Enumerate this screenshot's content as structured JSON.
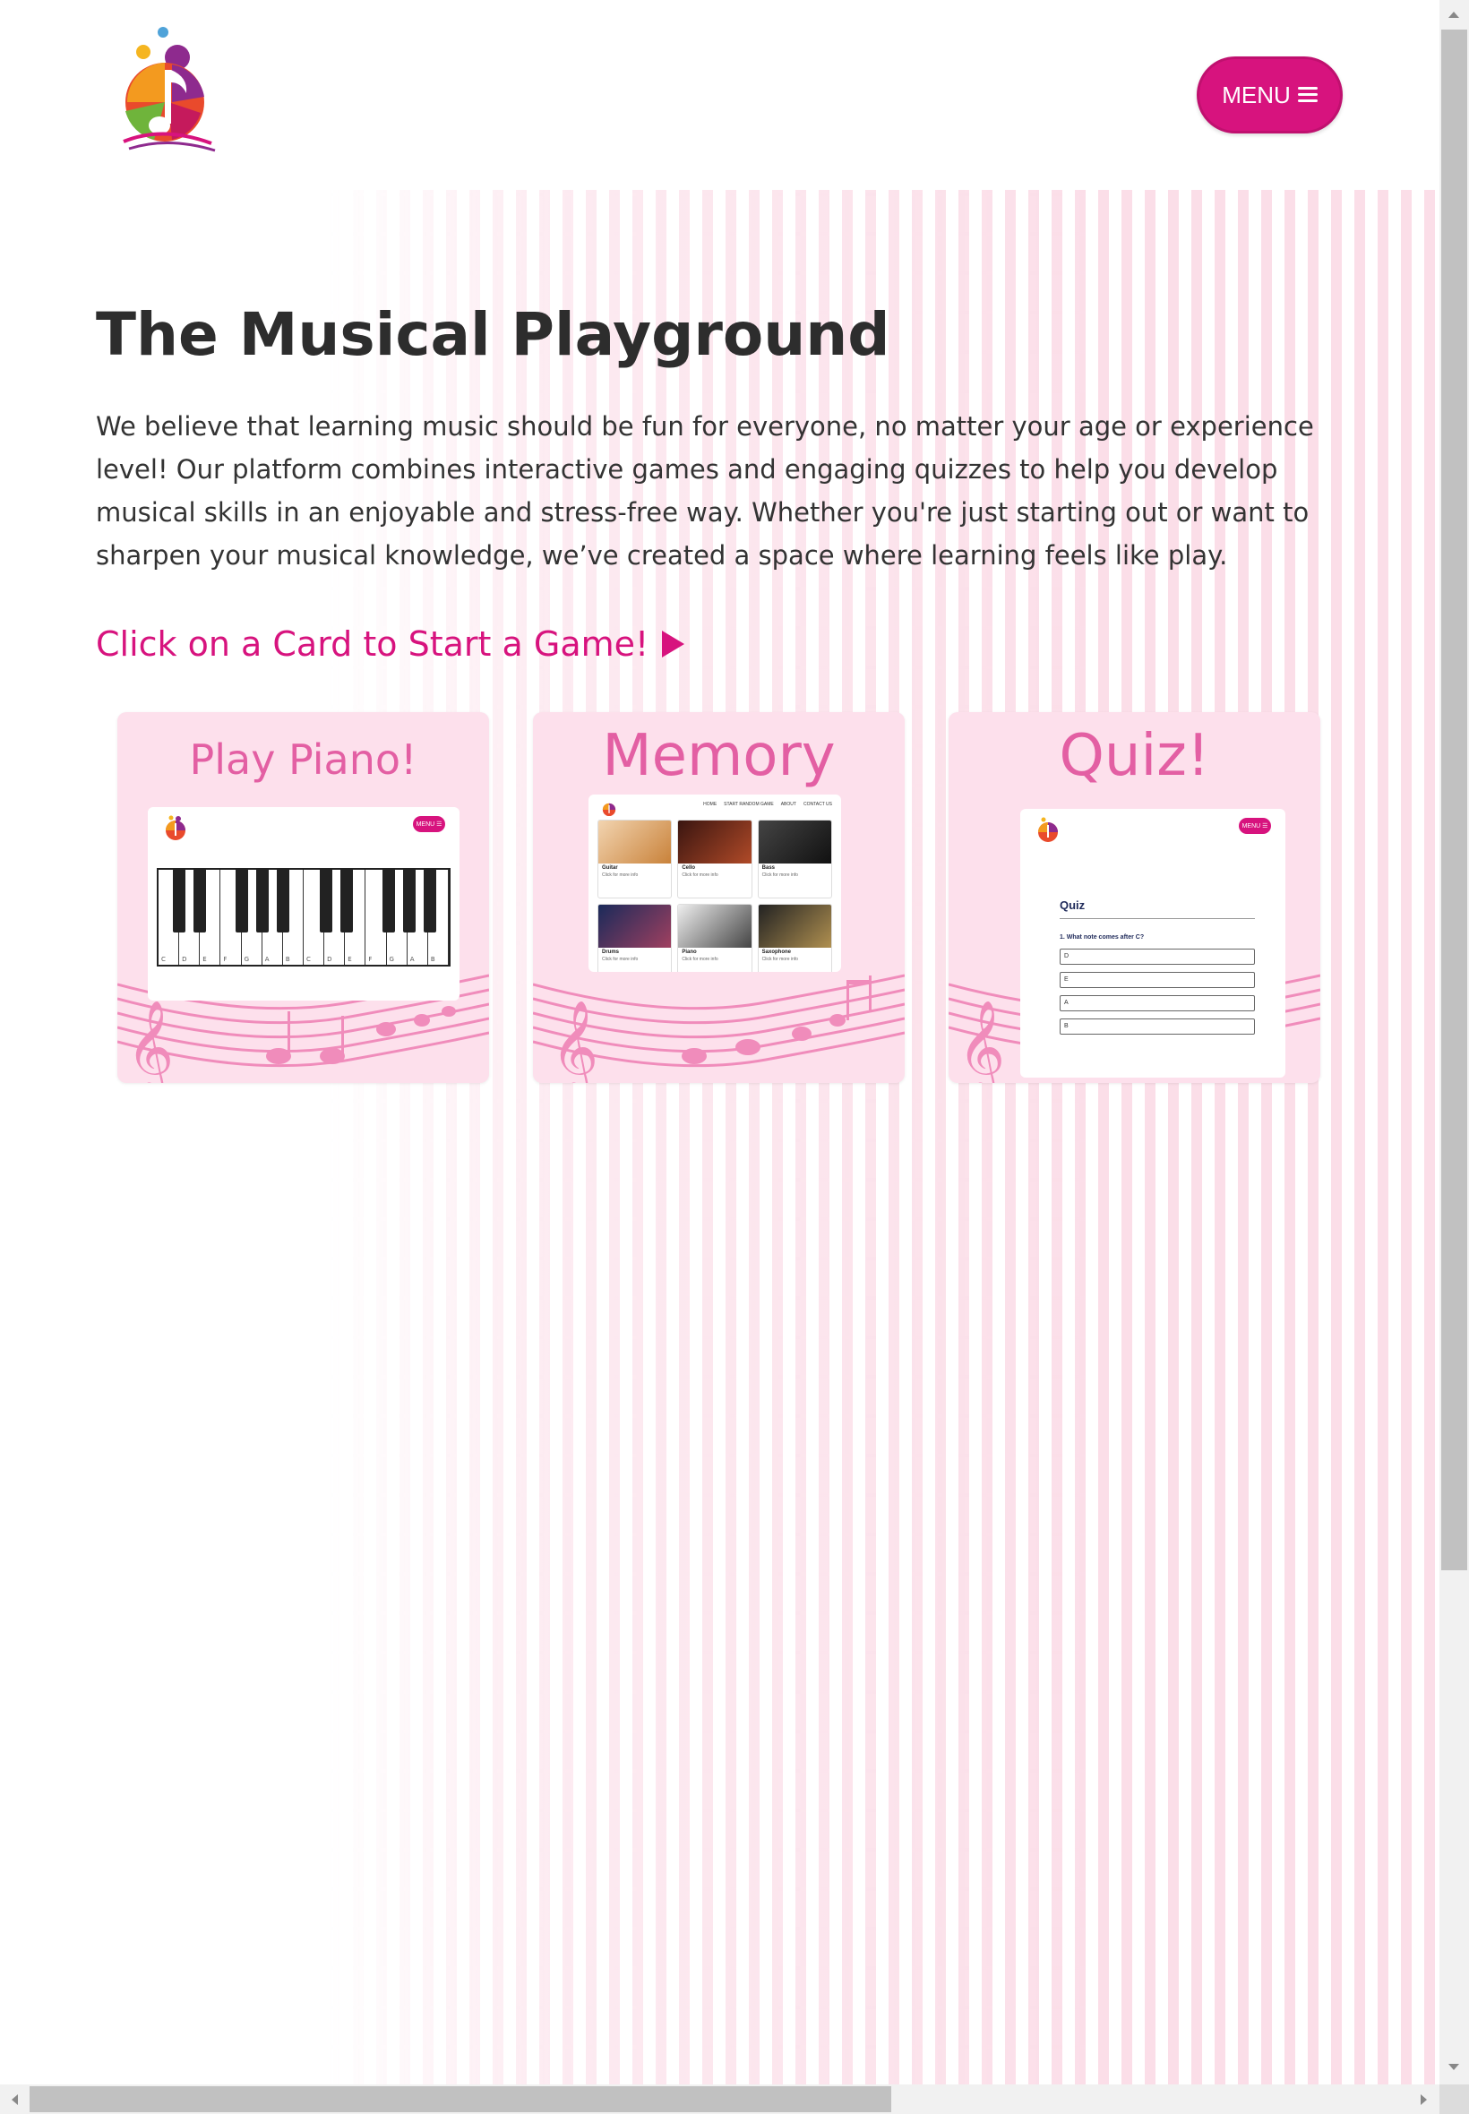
{
  "header": {
    "logo_icon": "music-note-logo",
    "menu_label": "MENU",
    "menu_icon": "hamburger-icon",
    "brand_color": "#d7137e"
  },
  "main": {
    "title": "The Musical Playground",
    "intro": "We believe that learning music should be fun for everyone, no matter your age or experience level! Our platform combines interactive games and engaging quizzes to help you develop musical skills in an enjoyable and stress-free way. Whether you're just starting out or want to sharpen your musical knowledge, we’ve created a space where learning feels like play.",
    "cta": "Click on a Card to Start a Game!",
    "cta_icon": "play-icon"
  },
  "cards": [
    {
      "title": "Play Piano!",
      "preview": {
        "menu_label": "MENU ☰",
        "keys": [
          "C",
          "D",
          "E",
          "F",
          "G",
          "A",
          "B",
          "C",
          "D",
          "E",
          "F",
          "G",
          "A",
          "B"
        ]
      }
    },
    {
      "title": "Memory",
      "preview": {
        "nav": [
          "HOME",
          "START RANDOM GAME",
          "ABOUT",
          "CONTACT US"
        ],
        "items": [
          {
            "name": "Guitar",
            "sub": "Click for more info",
            "color": "#d9a066"
          },
          {
            "name": "Cello",
            "sub": "Click for more info",
            "color": "#7a3020"
          },
          {
            "name": "Bass",
            "sub": "Click for more info",
            "color": "#2b2b2b"
          },
          {
            "name": "Drums",
            "sub": "Click for more info",
            "color": "#3a2a44"
          },
          {
            "name": "Piano",
            "sub": "Click for more info",
            "color": "#7a7a7a"
          },
          {
            "name": "Saxophone",
            "sub": "Click for more info",
            "color": "#4a4030"
          }
        ]
      }
    },
    {
      "title": "Quiz!",
      "preview": {
        "menu_label": "MENU ☰",
        "heading": "Quiz",
        "question": "1. What note comes after C?",
        "options": [
          "D",
          "E",
          "A",
          "B"
        ]
      }
    }
  ]
}
